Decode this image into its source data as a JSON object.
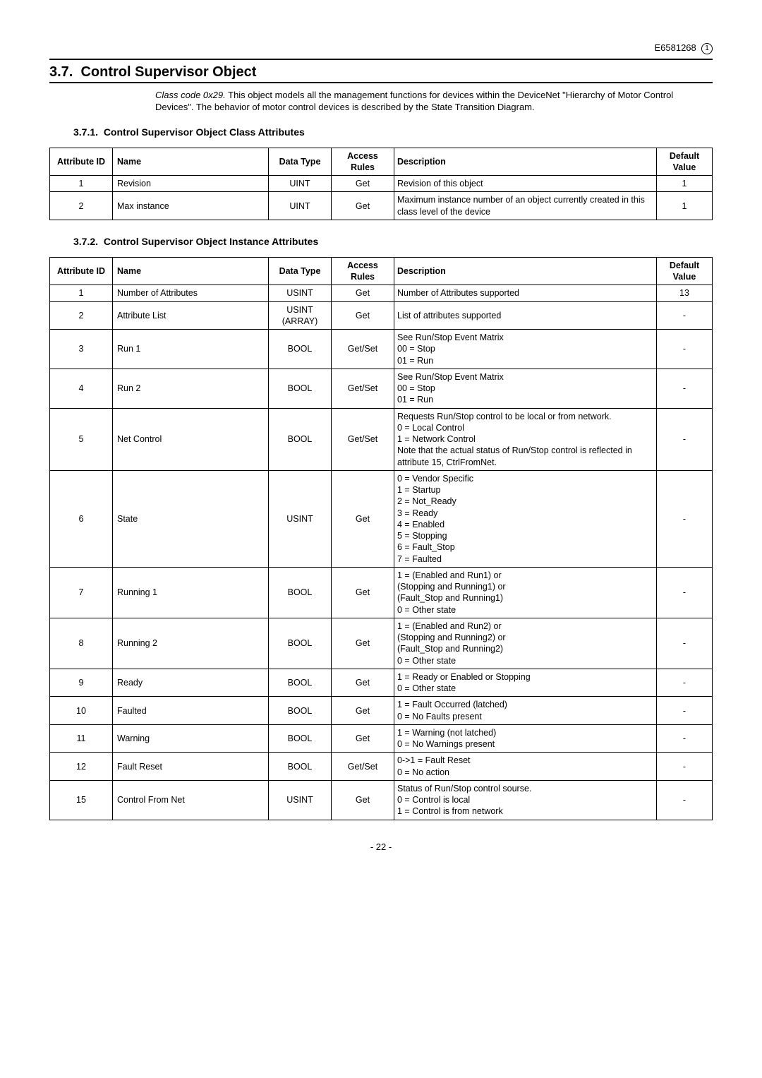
{
  "header": {
    "doc_number": "E6581268",
    "rev_mark": "1"
  },
  "section": {
    "number": "3.7.",
    "title": "Control Supervisor Object"
  },
  "intro": {
    "class_code": "Class code 0x29.",
    "text": "This object models all the management functions for devices within the DeviceNet \"Hierarchy of Motor Control Devices\". The behavior of motor control devices is described by the State Transition Diagram."
  },
  "sub1": {
    "number": "3.7.1.",
    "title": "Control Supervisor Object Class Attributes"
  },
  "sub2": {
    "number": "3.7.2.",
    "title": "Control Supervisor Object Instance Attributes"
  },
  "table_headers": {
    "id": "Attribute ID",
    "name": "Name",
    "type": "Data Type",
    "rules": "Access Rules",
    "desc": "Description",
    "def": "Default Value"
  },
  "class_rows": [
    {
      "id": "1",
      "name": "Revision",
      "type": "UINT",
      "rules": "Get",
      "desc": "Revision of this object",
      "def": "1"
    },
    {
      "id": "2",
      "name": "Max instance",
      "type": "UINT",
      "rules": "Get",
      "desc": "Maximum instance number of an object currently created in this class level of the device",
      "def": "1"
    }
  ],
  "inst_rows": [
    {
      "id": "1",
      "name": "Number of Attributes",
      "type": "USINT",
      "rules": "Get",
      "desc": "Number of Attributes supported",
      "def": "13"
    },
    {
      "id": "2",
      "name": "Attribute List",
      "type": "USINT (ARRAY)",
      "rules": "Get",
      "desc": "List of attributes supported",
      "def": "-"
    },
    {
      "id": "3",
      "name": "Run 1",
      "type": "BOOL",
      "rules": "Get/Set",
      "desc": "See Run/Stop Event Matrix\n00 = Stop\n01 = Run",
      "def": "-"
    },
    {
      "id": "4",
      "name": "Run 2",
      "type": "BOOL",
      "rules": "Get/Set",
      "desc": "See Run/Stop Event Matrix\n00 = Stop\n01 = Run",
      "def": "-"
    },
    {
      "id": "5",
      "name": "Net Control",
      "type": "BOOL",
      "rules": "Get/Set",
      "desc": "Requests Run/Stop control to be local or from network.\n0 = Local Control\n1 = Network Control\nNote that the actual status of Run/Stop control is reflected in attribute 15, CtrlFromNet.",
      "def": "-"
    },
    {
      "id": "6",
      "name": "State",
      "type": "USINT",
      "rules": "Get",
      "desc": "0 = Vendor Specific\n1 = Startup\n2 = Not_Ready\n3 = Ready\n4 = Enabled\n5 = Stopping\n6 = Fault_Stop\n7 = Faulted",
      "def": "-"
    },
    {
      "id": "7",
      "name": "Running 1",
      "type": "BOOL",
      "rules": "Get",
      "desc": "1 = (Enabled and Run1) or\n      (Stopping and Running1) or\n      (Fault_Stop and Running1)\n0 = Other state",
      "def": "-"
    },
    {
      "id": "8",
      "name": "Running 2",
      "type": "BOOL",
      "rules": "Get",
      "desc": "1 = (Enabled and Run2) or\n      (Stopping and Running2) or\n      (Fault_Stop and Running2)\n0 = Other state",
      "def": "-"
    },
    {
      "id": "9",
      "name": "Ready",
      "type": "BOOL",
      "rules": "Get",
      "desc": "1 = Ready or Enabled or Stopping\n0 = Other state",
      "def": "-"
    },
    {
      "id": "10",
      "name": "Faulted",
      "type": "BOOL",
      "rules": "Get",
      "desc": "1 = Fault Occurred (latched)\n0 = No Faults present",
      "def": "-"
    },
    {
      "id": "11",
      "name": "Warning",
      "type": "BOOL",
      "rules": "Get",
      "desc": "1 = Warning (not latched)\n0 = No Warnings present",
      "def": "-"
    },
    {
      "id": "12",
      "name": "Fault Reset",
      "type": "BOOL",
      "rules": "Get/Set",
      "desc": "0->1 = Fault Reset\n0 = No action",
      "def": "-"
    },
    {
      "id": "15",
      "name": "Control From Net",
      "type": "USINT",
      "rules": "Get",
      "desc": "Status of Run/Stop control sourse.\n0 = Control is local\n1 = Control is from network",
      "def": "-"
    }
  ],
  "page_number": "- 22 -"
}
